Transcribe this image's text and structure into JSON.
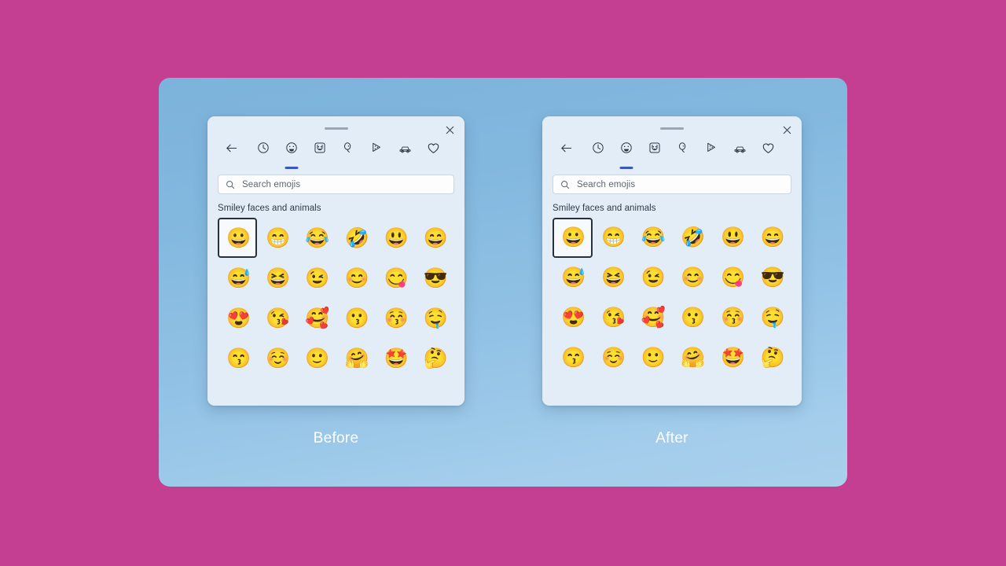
{
  "background": {
    "color": "#c43f91"
  },
  "card": {
    "gradient_from": "#7cb3dc",
    "gradient_to": "#a9d0ec"
  },
  "captions": {
    "before": "Before",
    "after": "After"
  },
  "panel": {
    "titlebar": {
      "drag_handle": "drag-handle",
      "close_label": "Close"
    },
    "tabs": [
      {
        "name": "back",
        "icon": "back-arrow-icon",
        "active": false
      },
      {
        "name": "recent",
        "icon": "clock-icon",
        "active": false
      },
      {
        "name": "emoji",
        "icon": "smiley-face-icon",
        "active": true
      },
      {
        "name": "gifs",
        "icon": "person-portrait-icon",
        "active": false
      },
      {
        "name": "kaomoji",
        "icon": "balloon-icon",
        "active": false
      },
      {
        "name": "symbols",
        "icon": "pizza-slice-icon",
        "active": false
      },
      {
        "name": "travel",
        "icon": "car-icon",
        "active": false
      },
      {
        "name": "favorites",
        "icon": "heart-icon",
        "active": false
      }
    ],
    "search": {
      "icon": "search-icon",
      "placeholder": "Search emojis",
      "value": ""
    },
    "section_title": "Smiley faces and animals",
    "emojis": [
      {
        "name": "grinning-face",
        "char": "😀",
        "selected": true
      },
      {
        "name": "beaming-face-with-smiling-eyes",
        "char": "😁",
        "selected": false
      },
      {
        "name": "face-with-tears-of-joy",
        "char": "😂",
        "selected": false
      },
      {
        "name": "rolling-on-the-floor-laughing",
        "char": "🤣",
        "selected": false
      },
      {
        "name": "grinning-face-with-big-eyes",
        "char": "😃",
        "selected": false
      },
      {
        "name": "grinning-face-with-smiling-eyes",
        "char": "😄",
        "selected": false
      },
      {
        "name": "grinning-face-with-sweat",
        "char": "😅",
        "selected": false
      },
      {
        "name": "squinting-face-with-tongue",
        "char": "😆",
        "selected": false
      },
      {
        "name": "winking-face",
        "char": "😉",
        "selected": false
      },
      {
        "name": "smiling-face-with-smiling-eyes",
        "char": "😊",
        "selected": false
      },
      {
        "name": "face-savoring-food",
        "char": "😋",
        "selected": false
      },
      {
        "name": "smiling-face-with-sunglasses",
        "char": "😎",
        "selected": false
      },
      {
        "name": "smiling-face-with-heart-eyes",
        "char": "😍",
        "selected": false
      },
      {
        "name": "face-blowing-a-kiss",
        "char": "😘",
        "selected": false
      },
      {
        "name": "smiling-face-with-hearts",
        "char": "🥰",
        "selected": false
      },
      {
        "name": "kissing-face",
        "char": "😗",
        "selected": false
      },
      {
        "name": "kissing-face-with-closed-eyes",
        "char": "😚",
        "selected": false
      },
      {
        "name": "drooling-face",
        "char": "🤤",
        "selected": false
      },
      {
        "name": "kissing-face-with-smiling-eyes",
        "char": "😙",
        "selected": false
      },
      {
        "name": "smiling-face",
        "char": "☺️",
        "selected": false
      },
      {
        "name": "slightly-smiling-face",
        "char": "🙂",
        "selected": false
      },
      {
        "name": "smiling-face-with-open-hands",
        "char": "🤗",
        "selected": false
      },
      {
        "name": "star-struck",
        "char": "🤩",
        "selected": false
      },
      {
        "name": "thinking-face",
        "char": "🤔",
        "selected": false
      }
    ]
  }
}
